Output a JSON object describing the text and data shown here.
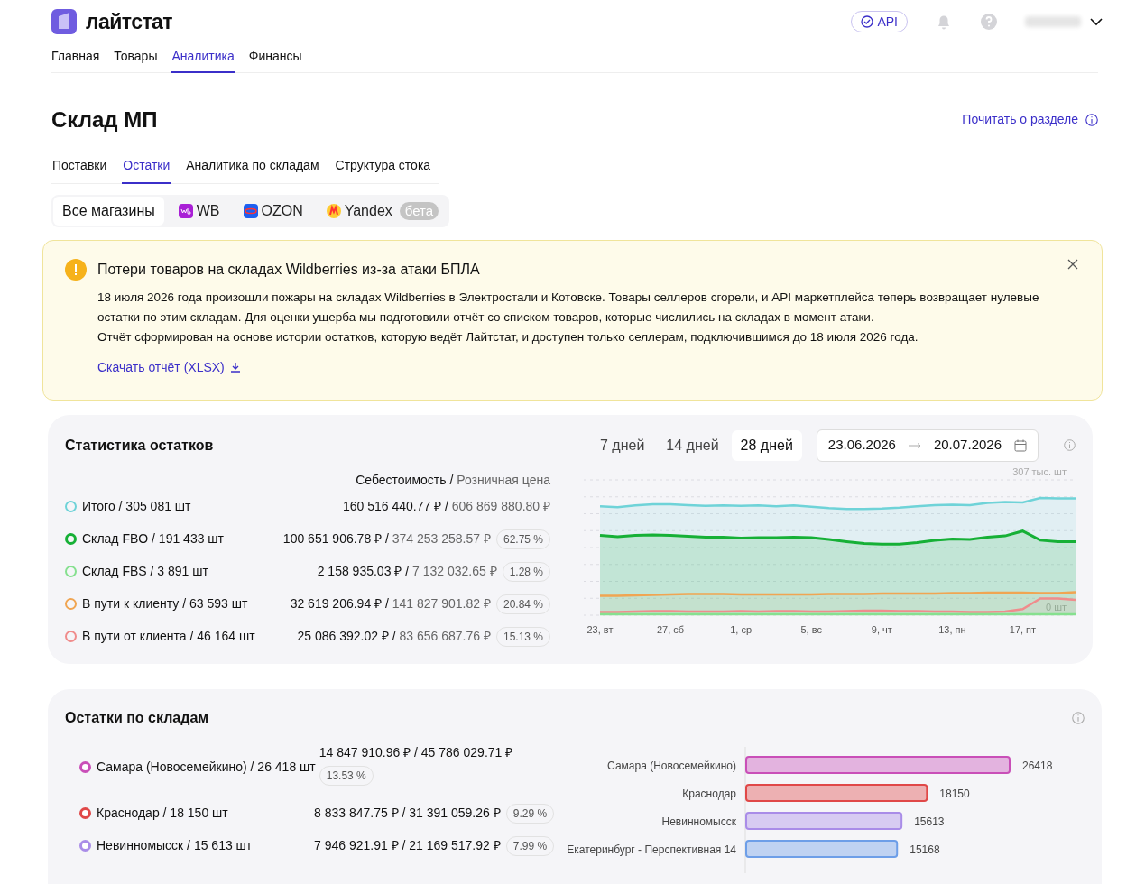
{
  "header": {
    "logo": "лайтстат",
    "api_button": "API",
    "nav": [
      {
        "label": "Главная",
        "selected": false
      },
      {
        "label": "Товары",
        "selected": false
      },
      {
        "label": "Аналитика",
        "selected": true
      },
      {
        "label": "Финансы",
        "selected": false
      }
    ]
  },
  "page": {
    "title": "Склад МП",
    "help_link": "Почитать о разделе",
    "tabs": [
      {
        "label": "Поставки",
        "selected": false
      },
      {
        "label": "Остатки",
        "selected": true
      },
      {
        "label": "Аналитика по складам",
        "selected": false
      },
      {
        "label": "Структура стока",
        "selected": false
      }
    ],
    "stores": [
      {
        "kind": "all",
        "label": "Все магазины",
        "selected": true
      },
      {
        "kind": "wb",
        "label": "WB",
        "selected": false
      },
      {
        "kind": "ozon",
        "label": "OZON",
        "selected": false
      },
      {
        "kind": "yandex",
        "label": "Yandex",
        "badge": "бета",
        "selected": false
      }
    ]
  },
  "alert": {
    "title": "Потери товаров на складах Wildberries из-за атаки БПЛА",
    "lines": [
      "18 июля 2026 года произошли пожары на складах Wildberries в Электростали и Котовске. Товары селлеров сгорели, и API маркетплейса теперь возвращает нулевые остатки по этим складам. Для оценки ущерба мы подготовили отчёт со списком товаров, которые числились на складах в момент атаки.",
      "Отчёт сформирован на основе истории остатков, которую ведёт Лайтстат, и доступен только селлерам, подключившимся до 18 июля 2026 года."
    ],
    "link": "Скачать отчёт (XLSX)"
  },
  "stock_stats": {
    "title": "Статистика остатков",
    "periods": [
      {
        "label": "7 дней",
        "selected": false
      },
      {
        "label": "14 дней",
        "selected": false
      },
      {
        "label": "28 дней",
        "selected": true
      }
    ],
    "date_from": "23.06.2026",
    "date_to": "20.07.2026",
    "column_header_cost": "Себестоимость",
    "column_header_separator": "/",
    "column_header_retail": "Розничная цена",
    "rows": [
      {
        "label": "Итого / 305 081 шт",
        "cost": "160 516 440.77 ₽",
        "separator": "/",
        "retail": "606 869 880.80 ₽",
        "color": "#6fd3d8"
      },
      {
        "label": "Склад FBO / 191 433 шт",
        "cost": "100 651 906.78 ₽",
        "separator": "/",
        "retail": "374 253 258.57 ₽",
        "share": "62.75 %",
        "color": "#16b036"
      },
      {
        "label": "Склад FBS / 3 891 шт",
        "cost": "2 158 935.03 ₽",
        "separator": "/",
        "retail": "7 132 032.65 ₽",
        "share": "1.28 %",
        "color": "#86e08f"
      },
      {
        "label": "В пути к клиенту / 63 593 шт",
        "cost": "32 619 206.94 ₽",
        "separator": "/",
        "retail": "141 827 901.82 ₽",
        "share": "20.84 %",
        "color": "#f0a552"
      },
      {
        "label": "В пути от клиента / 46 164 шт",
        "cost": "25 086 392.02 ₽",
        "separator": "/",
        "retail": "83 656 687.76 ₽",
        "share": "15.13 %",
        "color": "#f08c8c"
      }
    ],
    "chart_data": {
      "type": "area",
      "stacked": false,
      "ylim": [
        0,
        307
      ],
      "yticks": [
        {
          "value": 307,
          "label": "307 тыс. шт"
        },
        {
          "value": 0,
          "label": "0 шт"
        }
      ],
      "categories": [
        "23, вт",
        null,
        null,
        null,
        "27, сб",
        null,
        null,
        null,
        "1, ср",
        null,
        null,
        null,
        "5, вс",
        null,
        null,
        null,
        "9, чт",
        null,
        null,
        null,
        "13, пн",
        null,
        null,
        null,
        "17, пт",
        null,
        null,
        null
      ],
      "series": [
        {
          "color": "#6fd3d8",
          "values": [
            247,
            245,
            249,
            252,
            252,
            250,
            248,
            249,
            248,
            249,
            247,
            249,
            246,
            243,
            241,
            241,
            242,
            244,
            247,
            250,
            251,
            250,
            255,
            257,
            256,
            266,
            265,
            265
          ]
        },
        {
          "color": "#16b036",
          "values": [
            181,
            178,
            181,
            182,
            181,
            179,
            177,
            177,
            175,
            176,
            176,
            177,
            176,
            172,
            167,
            163,
            161,
            161,
            165,
            170,
            173,
            172,
            177,
            180,
            191,
            170,
            167,
            167
          ]
        },
        {
          "color": "#86e08f",
          "values": [
            2,
            2,
            2,
            2,
            2,
            2,
            2,
            2,
            2,
            2,
            2,
            2,
            2,
            2,
            2,
            2,
            2,
            2,
            2,
            2,
            2,
            2,
            2,
            2,
            2,
            2,
            2,
            2
          ]
        },
        {
          "color": "#f0a552",
          "values": [
            44,
            44,
            45,
            46,
            47,
            48,
            48,
            48,
            47,
            47,
            47,
            47,
            47,
            48,
            48,
            48,
            49,
            49,
            49,
            49,
            50,
            50,
            51,
            51,
            51,
            50,
            50,
            52
          ]
        },
        {
          "color": "#f08c8c",
          "values": [
            7,
            7,
            8,
            9,
            9,
            8,
            8,
            8,
            9,
            8,
            9,
            9,
            8,
            8,
            9,
            10,
            10,
            9,
            9,
            8,
            8,
            7,
            7,
            8,
            14,
            38,
            38,
            35
          ]
        }
      ]
    }
  },
  "warehouses": {
    "title": "Остатки по складам",
    "rows": [
      {
        "label": "Самара (Новосемейкино) / 26 418 шт",
        "value": "14 847 910.96 ₽ / 45 786 029.71 ₽",
        "share": "13.53 %",
        "color": "#c94fb8"
      },
      {
        "label": "Краснодар / 18 150 шт",
        "value": "8 833 847.75 ₽ / 31 391 059.26 ₽",
        "share": "9.29 %",
        "color": "#e04848"
      },
      {
        "label": "Невинномысск / 15 613 шт",
        "value": "7 946 921.91 ₽ / 21 169 517.92 ₽",
        "share": "7.99 %",
        "color": "#a98ce8"
      }
    ],
    "chart_data": {
      "type": "bar",
      "orientation": "horizontal",
      "categories": [
        "Самара (Новосемейкино)",
        "Краснодар",
        "Невинномысск",
        "Екатеринбург - Перспективная 14"
      ],
      "series": [
        {
          "values": [
            26418,
            18150,
            15613,
            15168
          ]
        }
      ],
      "data_labels": true,
      "colors": [
        "#c94fb8",
        "#e04848",
        "#a98ce8",
        "#6d9ee8"
      ]
    }
  }
}
